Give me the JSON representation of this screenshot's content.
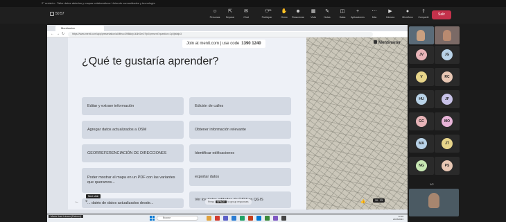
{
  "teams": {
    "title": "2° revisión - Taller datos abiertos y mapas colaborativos: Uniendo comunidades y tecnología",
    "timer": "50:57",
    "toolbar": [
      {
        "icon": "people-icon",
        "label": "Personas"
      },
      {
        "icon": "share-icon",
        "label": "Separar"
      },
      {
        "icon": "chat-icon",
        "label": "Chat"
      },
      {
        "icon": "participants-icon",
        "label": "Participar"
      },
      {
        "icon": "hand-icon",
        "label": "Gesto"
      },
      {
        "icon": "react-icon",
        "label": "Reaccionar"
      },
      {
        "icon": "view-icon",
        "label": "Vista"
      },
      {
        "icon": "notes-icon",
        "label": "Notas"
      },
      {
        "icon": "rooms-icon",
        "label": "Salas"
      },
      {
        "icon": "apps-icon",
        "label": "Aplicaciones"
      },
      {
        "icon": "more-icon",
        "label": "Más"
      },
      {
        "icon": "camera-icon",
        "label": "Cámara"
      },
      {
        "icon": "mic-icon",
        "label": "Micrófono"
      },
      {
        "icon": "share-screen-icon",
        "label": "Compartir"
      }
    ],
    "participant_count": "26",
    "leave_label": "Salir"
  },
  "browser": {
    "tab_title": "Mentimeter",
    "url": "https://www.menti.com/app/presentation/al4fifncc39f8kkfy1k3hf2m07fp0/present?question=2p0jhfatjx3"
  },
  "slide": {
    "join_text": "Join at menti.com | use code",
    "code": "1390 1240",
    "question": "¿Qué te gustaría aprender?",
    "brand": "Mentimeter",
    "options_left": [
      "Editar y extraer información",
      "Agregar datos actualizados a OSM",
      "GEORREFERENCIACIÓN DE DIRECCIONES",
      "Poder mostrar el mapa en un PDF con las variantes que queramos...",
      "... datos de datos actualizados desde..."
    ],
    "options_right": [
      "Edición de calles",
      "Obtener información relevante",
      "Identificar edificaciones",
      "exportar datos",
      "Ver los datos editados de OSM en QGIS"
    ],
    "tooltip": "Next slide",
    "hint_pre": "Press",
    "hint_key": "SPACE",
    "hint_post": "to group responses",
    "response_count": "10 · 23"
  },
  "participants": {
    "tiles": [
      {
        "initials": "JV",
        "color": "#e8b4b8"
      },
      {
        "initials": "JG",
        "color": "#b9d3e8"
      },
      {
        "initials": "V",
        "color": "#e8d58a"
      },
      {
        "initials": "RC",
        "color": "#e8c7b4"
      },
      {
        "initials": "HU",
        "color": "#b9d3e8"
      },
      {
        "initials": "JF",
        "color": "#c8c2e8"
      },
      {
        "initials": "GC",
        "color": "#e8b4b8"
      },
      {
        "initials": "MO",
        "color": "#e8b4d8"
      },
      {
        "initials": "MA",
        "color": "#b9d3e8"
      },
      {
        "initials": "JT",
        "color": "#e8d58a"
      },
      {
        "initials": "NG",
        "color": "#c8e8b4"
      },
      {
        "initials": "PS",
        "color": "#e8c7b4"
      }
    ],
    "pager": "1/2"
  },
  "presenter_name": "María José Lázaro (Externo)",
  "taskbar": {
    "search_placeholder": "Buscar",
    "clock": "12:18",
    "date": "20/06/2024"
  }
}
